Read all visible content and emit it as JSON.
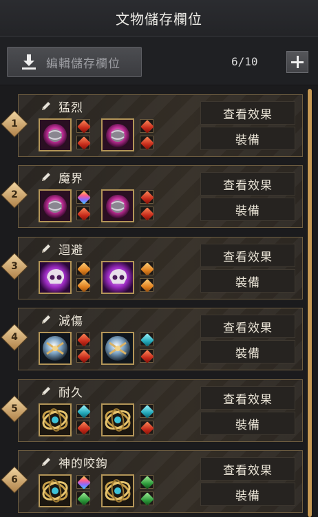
{
  "window": {
    "title": "文物儲存欄位"
  },
  "toolbar": {
    "edit_label": "編輯儲存欄位",
    "count": "6/10"
  },
  "slots": [
    {
      "number": "1",
      "name": "猛烈",
      "view_label": "查看效果",
      "equip_label": "裝備",
      "relic_type": "purple-orb",
      "gems": [
        "red",
        "red",
        "red",
        "red"
      ]
    },
    {
      "number": "2",
      "name": "魔界",
      "view_label": "查看效果",
      "equip_label": "裝備",
      "relic_type": "purple-orb",
      "gems": [
        "rainbow",
        "red",
        "red",
        "red"
      ]
    },
    {
      "number": "3",
      "name": "迴避",
      "view_label": "查看效果",
      "equip_label": "裝備",
      "relic_type": "crystal-skull",
      "gems": [
        "orange",
        "orange",
        "orange",
        "orange"
      ]
    },
    {
      "number": "4",
      "name": "減傷",
      "view_label": "查看效果",
      "equip_label": "裝備",
      "relic_type": "silver-orb",
      "gems": [
        "red",
        "red",
        "cyan",
        "red"
      ]
    },
    {
      "number": "5",
      "name": "耐久",
      "view_label": "查看效果",
      "equip_label": "裝備",
      "relic_type": "gold-rings",
      "gems": [
        "cyan",
        "red",
        "cyan",
        "red"
      ]
    },
    {
      "number": "6",
      "name": "神的咬鉤",
      "view_label": "查看效果",
      "equip_label": "裝備",
      "relic_type": "gold-rings",
      "gems": [
        "rainbow",
        "green",
        "green",
        "green"
      ]
    }
  ],
  "icons": {
    "download": "download-icon",
    "add": "plus-icon",
    "edit": "pencil-icon"
  },
  "colors": {
    "accent_gold": "#c79a55",
    "gem_red": "#d8442c",
    "gem_orange": "#e08a2a",
    "gem_cyan": "#2fb6c2",
    "gem_green": "#3aa447"
  }
}
